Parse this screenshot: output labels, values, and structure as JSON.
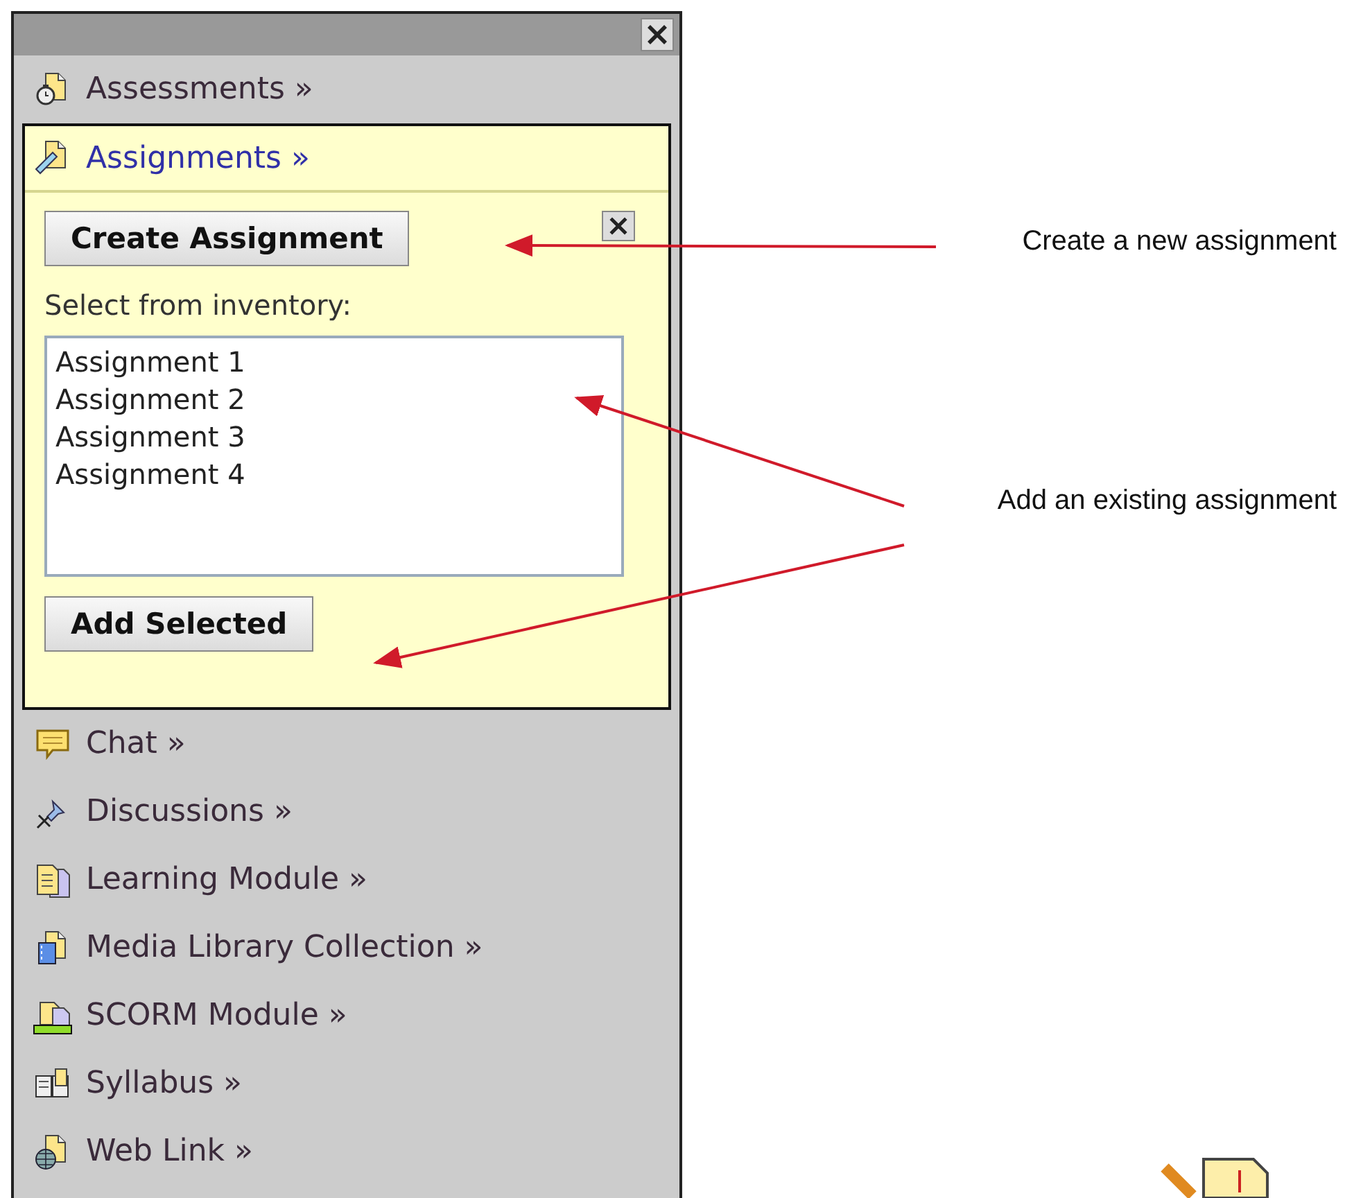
{
  "menu": {
    "items": [
      {
        "label": "Assessments",
        "kind": "assessment",
        "expanded": false
      },
      {
        "label": "Assignments",
        "kind": "assignment",
        "expanded": true,
        "panel": {
          "create_button": "Create Assignment",
          "select_label": "Select from inventory:",
          "inventory": [
            {
              "label": "Assignment 1",
              "selected": false
            },
            {
              "label": "Assignment 2",
              "selected": false
            },
            {
              "label": "Assignment 3",
              "selected": false
            },
            {
              "label": "Assignment 4",
              "selected": false
            }
          ],
          "add_button": "Add Selected"
        }
      },
      {
        "label": "Chat",
        "kind": "chat",
        "expanded": false
      },
      {
        "label": "Discussions",
        "kind": "pin",
        "expanded": false
      },
      {
        "label": "Learning Module",
        "kind": "module",
        "expanded": false
      },
      {
        "label": "Media Library Collection",
        "kind": "media",
        "expanded": false
      },
      {
        "label": "SCORM Module",
        "kind": "scorm",
        "expanded": false
      },
      {
        "label": "Syllabus",
        "kind": "book",
        "expanded": false
      },
      {
        "label": "Web Link",
        "kind": "web",
        "expanded": false
      }
    ],
    "more_marker": "»"
  },
  "annotations": [
    {
      "text": "Create a new assignment"
    },
    {
      "text": "Add an existing assignment"
    }
  ]
}
